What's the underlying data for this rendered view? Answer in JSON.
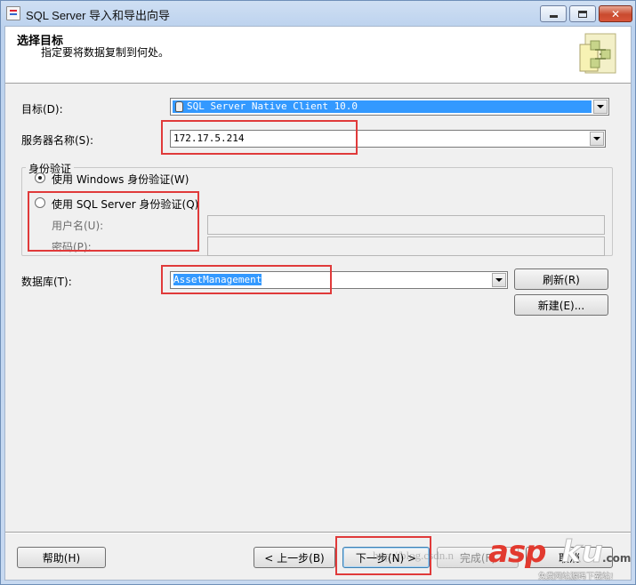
{
  "window": {
    "title": "SQL Server 导入和导出向导",
    "icons": {
      "app": "app-icon",
      "minimize": "minimize-icon",
      "maximize": "maximize-icon",
      "close": "close-icon"
    }
  },
  "header": {
    "title": "选择目标",
    "subtitle": "指定要将数据复制到何处。",
    "graphic": "wizard-graphic-icon"
  },
  "destination": {
    "label": "目标(D):",
    "value": "SQL Server Native Client 10.0",
    "icon": "data-source-icon"
  },
  "server": {
    "label": "服务器名称(S):",
    "value": "172.17.5.214"
  },
  "auth": {
    "group_label": "身份验证",
    "windows_option": "使用 Windows 身份验证(W)",
    "sql_option": "使用 SQL Server 身份验证(Q)",
    "username_label": "用户名(U):",
    "password_label": "密码(P):",
    "selected": "windows"
  },
  "database": {
    "label": "数据库(T):",
    "value": "AssetManagement",
    "refresh_label": "刷新(R)",
    "new_label": "新建(E)..."
  },
  "footer": {
    "help_label": "帮助(H)",
    "back_label": "< 上一步(B)",
    "next_label": "下一步(N) >",
    "finish_label": "完成(F)",
    "cancel_label": "取消"
  },
  "watermark": {
    "brand_asp": "asp",
    "brand_ku": "ku",
    "brand_com": ".com",
    "tagline": "免费网站源码下载站!",
    "url_text": "http://blog.csdn.n"
  },
  "colors": {
    "highlight": "#3399ff",
    "annotation_red": "#e03a3a",
    "title_bar": "#c9daf0"
  }
}
